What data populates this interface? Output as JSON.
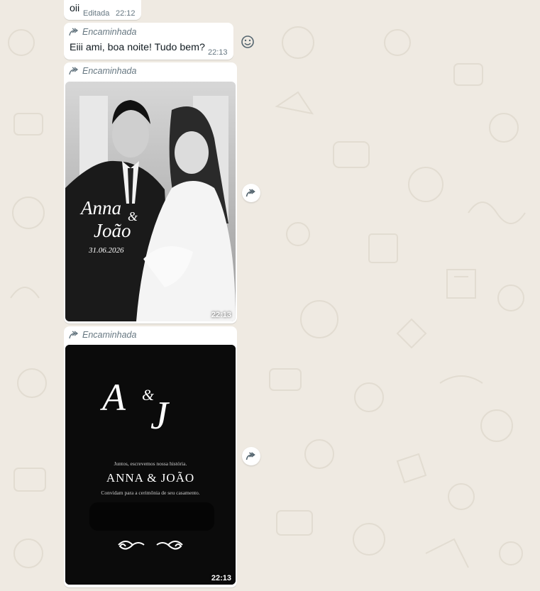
{
  "messages": [
    {
      "text": "oii",
      "edited_label": "Editada",
      "time": "22:12"
    },
    {
      "forwarded_label": "Encaminhada",
      "text": "Eiii ami, boa noite! Tudo bem?",
      "time": "22:13"
    },
    {
      "forwarded_label": "Encaminhada",
      "type": "image",
      "overlay": {
        "names_line1": "Anna",
        "amp": "&",
        "names_line2": "João",
        "date": "31.06.2026"
      },
      "time": "22:13"
    },
    {
      "forwarded_label": "Encaminhada",
      "type": "image",
      "overlay": {
        "monogram_a": "A",
        "monogram_amp": "&",
        "monogram_j": "J",
        "tagline": "Juntos, escrevemos nossa história.",
        "names": "ANNA & JOÃO",
        "invite": "Convidam para a cerimônia de seu casamento."
      },
      "time": "22:13"
    }
  ],
  "icons": {
    "react": "smiley-icon",
    "forward": "forward-arrow-icon"
  },
  "colors": {
    "bg": "#efeae2",
    "bubble": "#ffffff",
    "meta": "#667781"
  }
}
